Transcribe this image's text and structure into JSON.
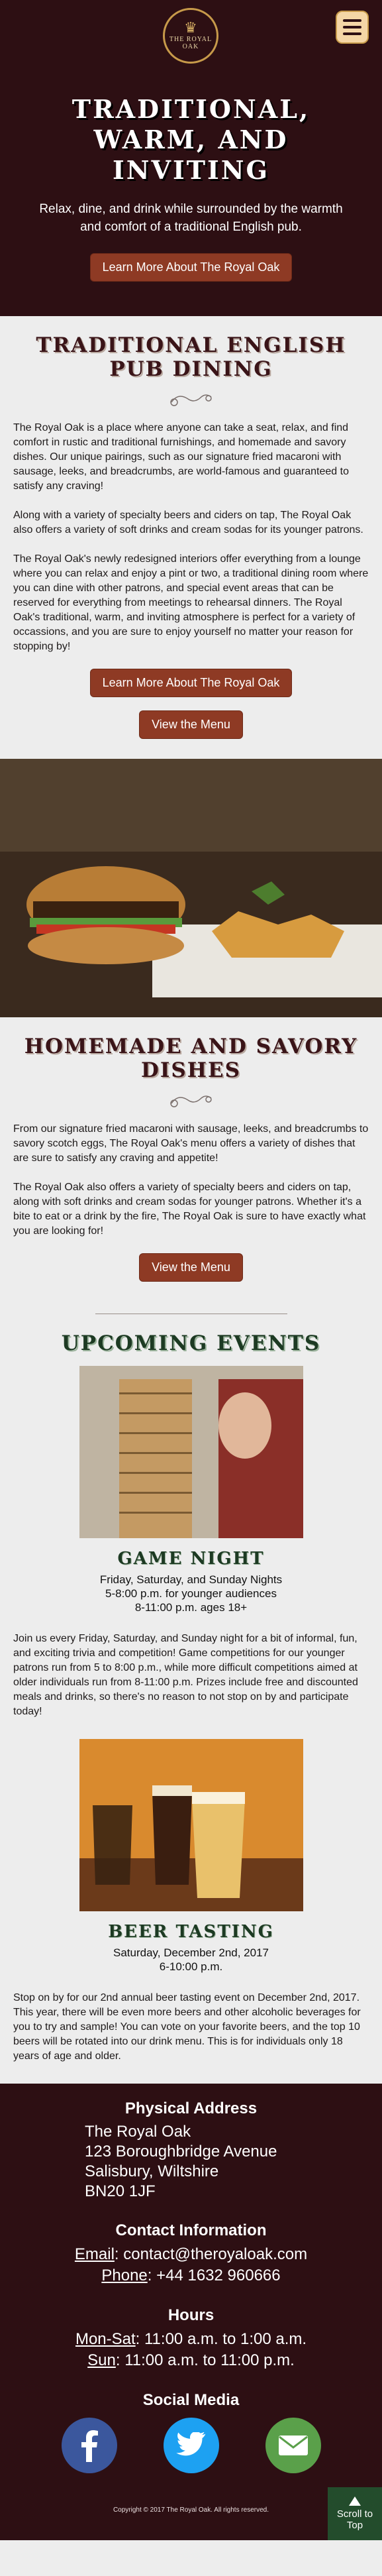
{
  "header": {
    "logo_text": "THE ROYAL OAK",
    "crown_icon": "crown-icon",
    "menu_icon": "hamburger-menu-icon"
  },
  "hero": {
    "title": "Traditional, Warm, and Inviting",
    "subtitle": "Relax, dine, and drink while surrounded by the warmth and comfort of a traditional English pub.",
    "button": "Learn More About The Royal Oak"
  },
  "dining": {
    "title": "Traditional English Pub Dining",
    "paragraphs": [
      "The Royal Oak is a place where anyone can take a seat, relax, and find comfort in rustic and traditional furnishings, and homemade and savory dishes. Our unique pairings, such as our signature fried macaroni with sausage, leeks, and breadcrumbs, are world-famous and guaranteed to satisfy any craving!",
      "Along with a variety of specialty beers and ciders on tap, The Royal Oak also offers a variety of soft drinks and cream sodas for its younger patrons.",
      "The Royal Oak's newly redesigned interiors offer everything from a lounge where you can relax and enjoy a pint or two, a traditional dining room where you can dine with other patrons, and special event areas that can be reserved for everything from meetings to rehearsal dinners. The Royal Oak's traditional, warm, and inviting atmosphere is perfect for a variety of occassions, and you are sure to enjoy yourself no matter your reason for stopping by!"
    ],
    "learn_button": "Learn More About The Royal Oak",
    "menu_button": "View the Menu"
  },
  "dishes": {
    "title": "Homemade and Savory Dishes",
    "paragraphs": [
      "From our signature fried macaroni with sausage, leeks, and breadcrumbs to savory scotch eggs, The Royal Oak's menu offers a variety of dishes that are sure to satisfy any craving and appetite!",
      "The Royal Oak also offers a variety of specialty beers and ciders on tap, along with soft drinks and cream sodas for younger patrons. Whether it's a bite to eat or a drink by the fire, The Royal Oak is sure to have exactly what you are looking for!"
    ],
    "menu_button": "View the Menu"
  },
  "events": {
    "title": "Upcoming Events",
    "items": [
      {
        "name": "Game Night",
        "line1": "Friday, Saturday, and Sunday Nights",
        "line2": "5-8:00 p.m. for younger audiences",
        "line3": "8-11:00 p.m. ages 18+",
        "description": "Join us every Friday, Saturday, and Sunday night for a bit of informal, fun, and exciting trivia and competition! Game competitions for our younger patrons run from 5 to 8:00 p.m., while more difficult competitions aimed at older individuals run from 8-11:00 p.m. Prizes include free and discounted meals and drinks, so there's no reason to not stop on by and participate today!"
      },
      {
        "name": "Beer Tasting",
        "line1": "Saturday, December 2nd, 2017",
        "line2": "6-10:00 p.m.",
        "description": "Stop on by for our 2nd annual beer tasting event on December 2nd, 2017. This year, there will be even more beers and other alcoholic beverages for you to try and sample! You can vote on your favorite beers, and the top 10 beers will be rotated into our drink menu. This is for individuals only 18 years of age and older."
      }
    ]
  },
  "footer": {
    "address_title": "Physical Address",
    "address_lines": [
      "The Royal Oak",
      "123 Boroughbridge Avenue",
      "Salisbury, Wiltshire",
      "BN20 1JF"
    ],
    "contact_title": "Contact Information",
    "email_label": "Email",
    "email_value": ": contact@theroyaloak.com",
    "phone_label": "Phone",
    "phone_value": ": +44 1632 960666",
    "hours_title": "Hours",
    "hours_1_label": "Mon-Sat",
    "hours_1_value": ": 11:00 a.m. to 1:00 a.m.",
    "hours_2_label": "Sun",
    "hours_2_value": ": 11:00 a.m. to 11:00 p.m.",
    "social_title": "Social Media",
    "social_icons": [
      "facebook-icon",
      "twitter-icon",
      "email-icon"
    ],
    "copyright": "Copyright © 2017 The Royal Oak. All rights reserved.",
    "scroll_top": "Scroll to Top"
  },
  "colors": {
    "brand_dark": "#2d0f13",
    "button": "#8e3a24",
    "events_green": "#234c2c",
    "facebook": "#3b579d",
    "twitter": "#1da1f2",
    "email": "#5aa04a"
  }
}
